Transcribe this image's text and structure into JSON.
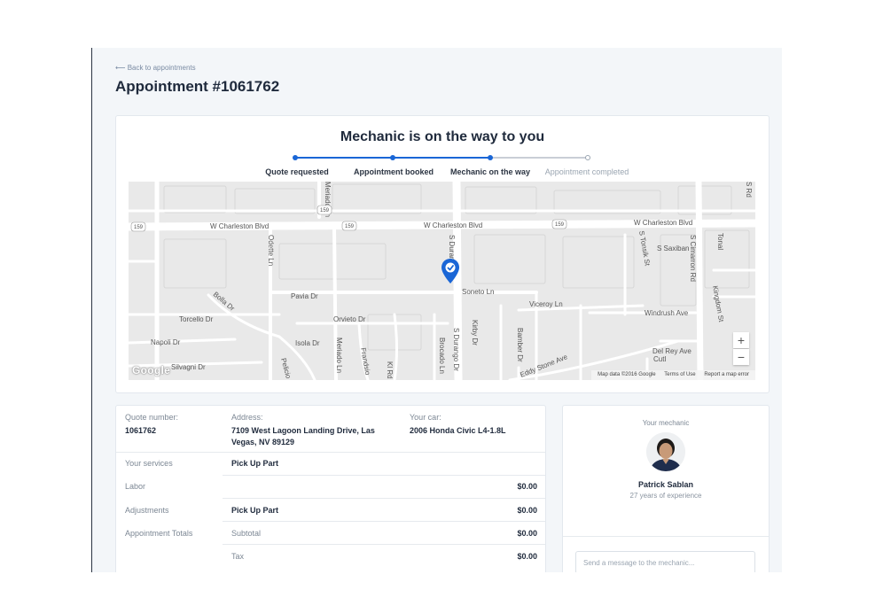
{
  "header": {
    "back_link": "⟵ Back to appointments",
    "title": "Appointment #1061762"
  },
  "status": {
    "heading": "Mechanic is on the way to you",
    "steps": [
      {
        "label": "Quote requested",
        "state": "done"
      },
      {
        "label": "Appointment booked",
        "state": "done"
      },
      {
        "label": "Mechanic on the way",
        "state": "current"
      },
      {
        "label": "Appointment completed",
        "state": "pending"
      }
    ],
    "accent_color": "#1a66d6",
    "pending_color": "#c9ced6"
  },
  "map": {
    "streets": [
      "W Charleston Blvd",
      "W Charleston Blvd",
      "W Charleston Blvd",
      "Odette Ln",
      "Meriado Ln",
      "Pavia Dr",
      "Bolla Dr",
      "Torcello Dr",
      "Orvieto Dr",
      "Isola Dr",
      "Napoli Dr",
      "Silvagni Dr",
      "Pelicio",
      "Meriado Ln",
      "Frandsio",
      "Kl Rd",
      "Brocado Ln",
      "S Durango Dr",
      "S Durango Dr",
      "Soneto Ln",
      "Kirby Dr",
      "Viceroy Ln",
      "Bamber Dr",
      "Eddy Stone Ave",
      "Windrush Ave",
      "Del Rey Ave",
      "Cutl",
      "S Tonsik St",
      "S Saxiban",
      "S Cimarron Rd",
      "Kingdom St",
      "Tonal",
      "S Rd"
    ],
    "highway_shields": [
      "159",
      "159",
      "159",
      "159"
    ],
    "zoom_in": "+",
    "zoom_out": "−",
    "logo": "Google",
    "attribution": {
      "map_data": "Map data ©2016 Google",
      "terms": "Terms of Use",
      "report": "Report a map error"
    },
    "pin_color": "#1a66d6"
  },
  "details": {
    "quote_label": "Quote number:",
    "quote_value": "1061762",
    "address_label": "Address:",
    "address_line1": "7109 West Lagoon Landing Drive, Las",
    "address_line2": "Vegas, NV 89129",
    "car_label": "Your car:",
    "car_value": "2006 Honda Civic L4-1.8L",
    "rows": [
      {
        "label": "Your services",
        "item": "Pick Up Part",
        "amount": ""
      },
      {
        "label": "Labor",
        "item": "",
        "amount": "$0.00"
      },
      {
        "label": "Adjustments",
        "item": "Pick Up Part",
        "amount": "$0.00"
      },
      {
        "label": "Appointment Totals",
        "item": "Subtotal",
        "amount": "$0.00"
      },
      {
        "label": "",
        "item": "Tax",
        "amount": "$0.00"
      }
    ]
  },
  "mechanic": {
    "label": "Your mechanic",
    "name": "Patrick Sablan",
    "experience": "27 years of experience",
    "message_placeholder": "Send a message to the mechanic..."
  }
}
